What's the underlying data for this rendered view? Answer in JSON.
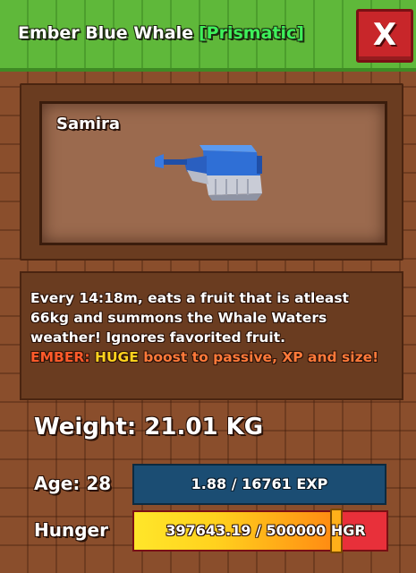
{
  "header": {
    "pet_name": "Ember Blue Whale",
    "variant_tag": "[Prismatic]",
    "close_label": "X"
  },
  "pet_display": {
    "owner_name": "Samira",
    "icon": "blue-whale-model"
  },
  "description": {
    "line1": "Every 14:18m, eats a fruit that is atleast",
    "line2": "66kg and summons the Whale Waters",
    "line3": "weather! Ignores favorited fruit.",
    "ember_word": "EMBER:",
    "ember_huge": "HUGE",
    "ember_rest": "boost to passive, XP and size!"
  },
  "stats": {
    "weight_text": "Weight: 21.01 KG",
    "age_text": "Age: 28",
    "exp_text": "1.88 / 16761 EXP",
    "exp_current": 1.88,
    "exp_max": 16761,
    "hunger_label": "Hunger",
    "hunger_text": "397643.19 / 500000 HGR",
    "hunger_current": 397643.19,
    "hunger_max": 500000
  },
  "colors": {
    "header_green": "#5fb83a",
    "variant_green": "#3ef05a",
    "close_red": "#c8262a",
    "exp_blue": "#1b4d73",
    "hunger_yellow": "#ffd21e",
    "hunger_red": "#e8303a",
    "ember_red": "#ff5a2a"
  }
}
